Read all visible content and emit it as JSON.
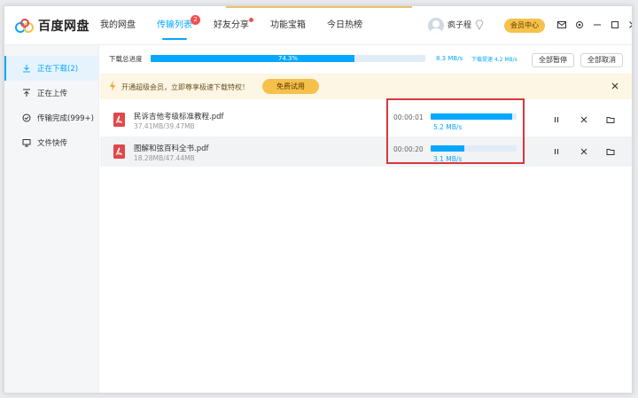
{
  "app": {
    "name": "百度网盘"
  },
  "nav": {
    "items": [
      {
        "label": "我的网盘"
      },
      {
        "label": "传输列表",
        "badge": "2"
      },
      {
        "label": "好友分享"
      },
      {
        "label": "功能宝箱"
      },
      {
        "label": "今日热榜"
      }
    ]
  },
  "user": {
    "name": "疯子程",
    "vip_label": "会员中心"
  },
  "sidebar": {
    "items": [
      {
        "label": "正在下载(2)"
      },
      {
        "label": "正在上传"
      },
      {
        "label": "传输完成(999+)"
      },
      {
        "label": "文件快传"
      }
    ]
  },
  "overall": {
    "label": "下载总进度",
    "percent_text": "74.3%",
    "percent": 74.3,
    "speed": "8.3 MB/s",
    "limit": "下载提速 4.2 MB/s",
    "pause_all": "全部暂停",
    "cancel_all": "全部取消"
  },
  "banner": {
    "text": "开通超级会员，立即尊享极速下载特权！",
    "button": "免费试用"
  },
  "files": [
    {
      "name": "民诉吉他考级标准教程.pdf",
      "size": "37.41MB/39.47MB",
      "time": "00:00:01",
      "speed": "5.2 MB/s",
      "progress": 0.95
    },
    {
      "name": "图解和弦百科全书.pdf",
      "size": "18.28MB/47.44MB",
      "time": "00:00:20",
      "speed": "3.1 MB/s",
      "progress": 0.39
    }
  ],
  "colors": {
    "accent": "#06a7ff",
    "vip": "#f6c14b",
    "highlight": "#d9363e",
    "pdf": "#e0484a"
  }
}
